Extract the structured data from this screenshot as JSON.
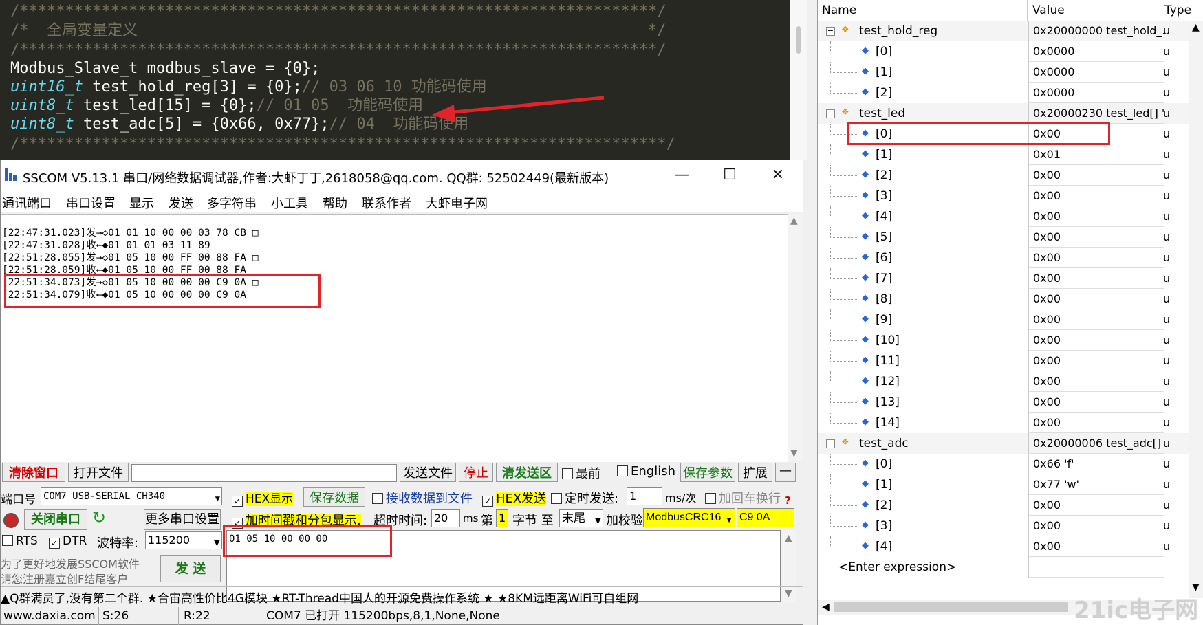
{
  "editor": {
    "lines": [
      "/**********************************************************************/",
      "/*  全局变量定义                                                        */",
      "/**********************************************************************/",
      "/***********************************************************************/"
    ],
    "code": {
      "line1": "Modbus_Slave_t modbus_slave = {0};",
      "line2_type": "uint16_t",
      "line2_rest": " test_hold_reg[3] = {0};",
      "line2_comment": "// 03 06 10 功能码使用",
      "line3_type": "uint8_t",
      "line3_rest": " test_led[15] = {0};",
      "line3_comment": "// 01 05  功能码使用",
      "line4_type": "uint8_t",
      "line4_rest": " test_adc[5] = {0x66, 0x77};",
      "line4_comment": "// 04  功能码使用"
    }
  },
  "sscom": {
    "title": "SSCOM V5.13.1 串口/网络数据调试器,作者:大虾丁丁,2618058@qq.com. QQ群:  52502449(最新版本)",
    "window_controls": [
      "—",
      "☐",
      "✕"
    ],
    "menu": [
      "通讯端口",
      "串口设置",
      "显示",
      "发送",
      "多字符串",
      "小工具",
      "帮助",
      "联系作者",
      "大虾电子网"
    ],
    "log": [
      "[22:47:31.023]发→◇01 01 10 00 00 03 78 CB □",
      "[22:47:31.028]收←◆01 01 01 03 11 89",
      "[22:51:28.055]发→◇01 05 10 00 FF 00 88 FA □",
      "[22:51:28.059]收←◆01 05 10 00 FF 00 88 FA",
      "[22:51:34.073]发→◇01 05 10 00 00 00 C9 0A □",
      "[22:51:34.079]收←◆01 05 10 00 00 00 C9 0A"
    ],
    "toolbar": {
      "clear": "清除窗口",
      "open_file": "打开文件",
      "send_file": "发送文件",
      "stop": "停止",
      "clear_send": "清发送区",
      "last": "最前",
      "english": "English",
      "save_params": "保存参数",
      "expand": "扩展",
      "collapse": "—"
    },
    "port": {
      "label": "端口号",
      "value": "COM7 USB-SERIAL CH340",
      "close_port": "关闭串口",
      "more_settings": "更多串口设置",
      "rts": "RTS",
      "dtr": "DTR",
      "baud_label": "波特率:",
      "baud": "115200"
    },
    "options": {
      "hex_display": "HEX显示",
      "save_data": "保存数据",
      "recv_to_file": "接收数据到文件",
      "hex_send": "HEX发送",
      "timed_send": "定时发送:",
      "timed_value": "1",
      "timed_unit": "ms/次",
      "add_crlf": "加回车换行",
      "timestamp": "加时间戳和分包显示,",
      "timeout_label": "超时时间:",
      "timeout_value": "20",
      "timeout_unit": "ms",
      "byte_from_label": "第",
      "byte_from": "1",
      "byte_to_label": "字节 至",
      "byte_to": "末尾",
      "checksum_label": "加校验",
      "checksum": "ModbusCRC16",
      "crc": "C9 0A",
      "help": "?"
    },
    "send_input": "01 05 10 00 00 00",
    "send_button": "发  送",
    "promo_line1": "为了更好地发展SSCOM软件",
    "promo_line2": "请您注册嘉立创F结尾客户",
    "ticker": "▲Q群满员了,没有第二个群. ★合宙高性价比4G模块 ★RT-Thread中国人的开源免费操作系统 ★ ★8KM远距离WiFi可自组网",
    "status": {
      "site": "www.daxia.com",
      "sent": "S:26",
      "recv": "R:22",
      "port_state": "COM7 已打开  115200bps,8,1,None,None"
    }
  },
  "watch": {
    "headers": {
      "name": "Name",
      "value": "Value",
      "type": "Type"
    },
    "groups": [
      {
        "name": "test_hold_reg",
        "value": "0x20000000 test_hold_...",
        "type": "u",
        "items": [
          {
            "i": "[0]",
            "v": "0x0000"
          },
          {
            "i": "[1]",
            "v": "0x0000"
          },
          {
            "i": "[2]",
            "v": "0x0000"
          }
        ]
      },
      {
        "name": "test_led",
        "value": "0x20000230 test_led[] \"\"",
        "type": "u",
        "items": [
          {
            "i": "[0]",
            "v": "0x00"
          },
          {
            "i": "[1]",
            "v": "0x01"
          },
          {
            "i": "[2]",
            "v": "0x00"
          },
          {
            "i": "[3]",
            "v": "0x00"
          },
          {
            "i": "[4]",
            "v": "0x00"
          },
          {
            "i": "[5]",
            "v": "0x00"
          },
          {
            "i": "[6]",
            "v": "0x00"
          },
          {
            "i": "[7]",
            "v": "0x00"
          },
          {
            "i": "[8]",
            "v": "0x00"
          },
          {
            "i": "[9]",
            "v": "0x00"
          },
          {
            "i": "[10]",
            "v": "0x00"
          },
          {
            "i": "[11]",
            "v": "0x00"
          },
          {
            "i": "[12]",
            "v": "0x00"
          },
          {
            "i": "[13]",
            "v": "0x00"
          },
          {
            "i": "[14]",
            "v": "0x00"
          }
        ]
      },
      {
        "name": "test_adc",
        "value": "0x20000006 test_adc[] ...",
        "type": "u",
        "items": [
          {
            "i": "[0]",
            "v": "0x66 'f'"
          },
          {
            "i": "[1]",
            "v": "0x77 'w'"
          },
          {
            "i": "[2]",
            "v": "0x00"
          },
          {
            "i": "[3]",
            "v": "0x00"
          },
          {
            "i": "[4]",
            "v": "0x00"
          }
        ]
      }
    ],
    "enter_expression": "<Enter expression>",
    "item_type": "u"
  },
  "watermark": "21ic电子网",
  "colors": {
    "annotation": "#e0242a",
    "editor_bg": "#272822",
    "checksum_bg": "#ffff00"
  }
}
